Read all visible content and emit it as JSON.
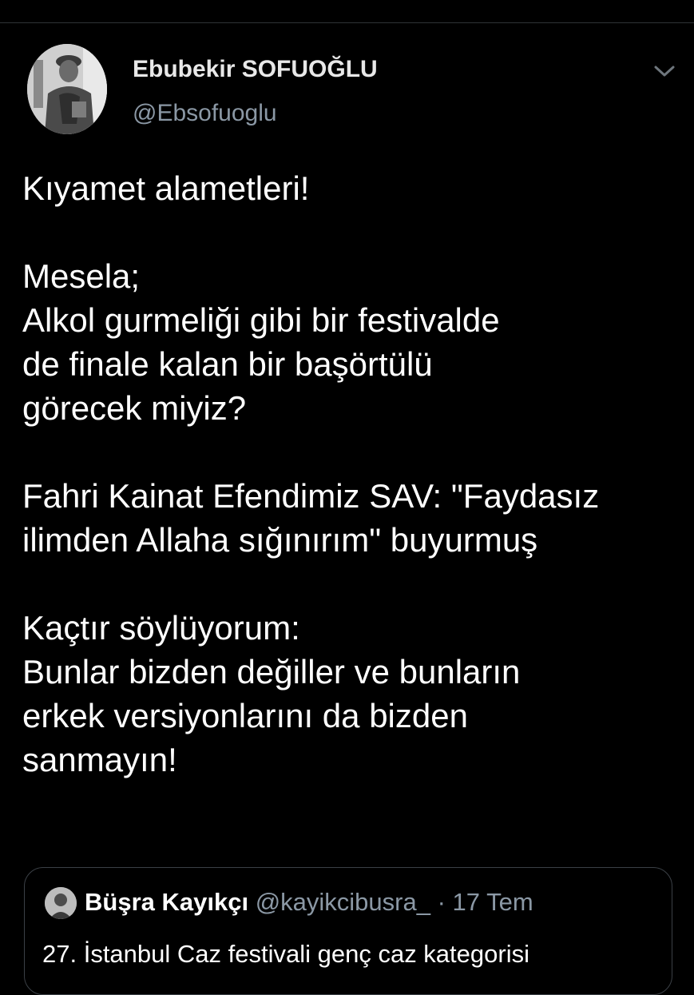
{
  "tweet": {
    "author": {
      "display_name": "Ebubekir SOFUOĞLU",
      "handle": "@Ebsofuoglu",
      "avatar_icon": "profile-photo"
    },
    "more_icon": "chevron-down-icon",
    "text_lines": [
      "Kıyamet alametleri!",
      "",
      "Mesela;",
      "Alkol gurmeliği gibi bir festivalde",
      "de finale kalan bir başörtülü",
      "görecek miyiz?",
      "",
      "Fahri Kainat Efendimiz SAV: \"Faydasız",
      "ilimden Allaha sığınırım\" buyurmuş",
      "",
      "Kaçtır söylüyorum:",
      "Bunlar bizden değiller ve bunların",
      "erkek versiyonlarını da bizden",
      "sanmayın!"
    ]
  },
  "quoted_tweet": {
    "display_name": "Büşra Kayıkçı",
    "handle": "@kayikcibusra_",
    "separator": "·",
    "date": "17 Tem",
    "text": "27. İstanbul Caz festivali genç caz kategorisi"
  },
  "colors": {
    "background": "#000000",
    "primary_text": "#ffffff",
    "secondary_text": "#8b98a5",
    "border": "#3b4046"
  }
}
